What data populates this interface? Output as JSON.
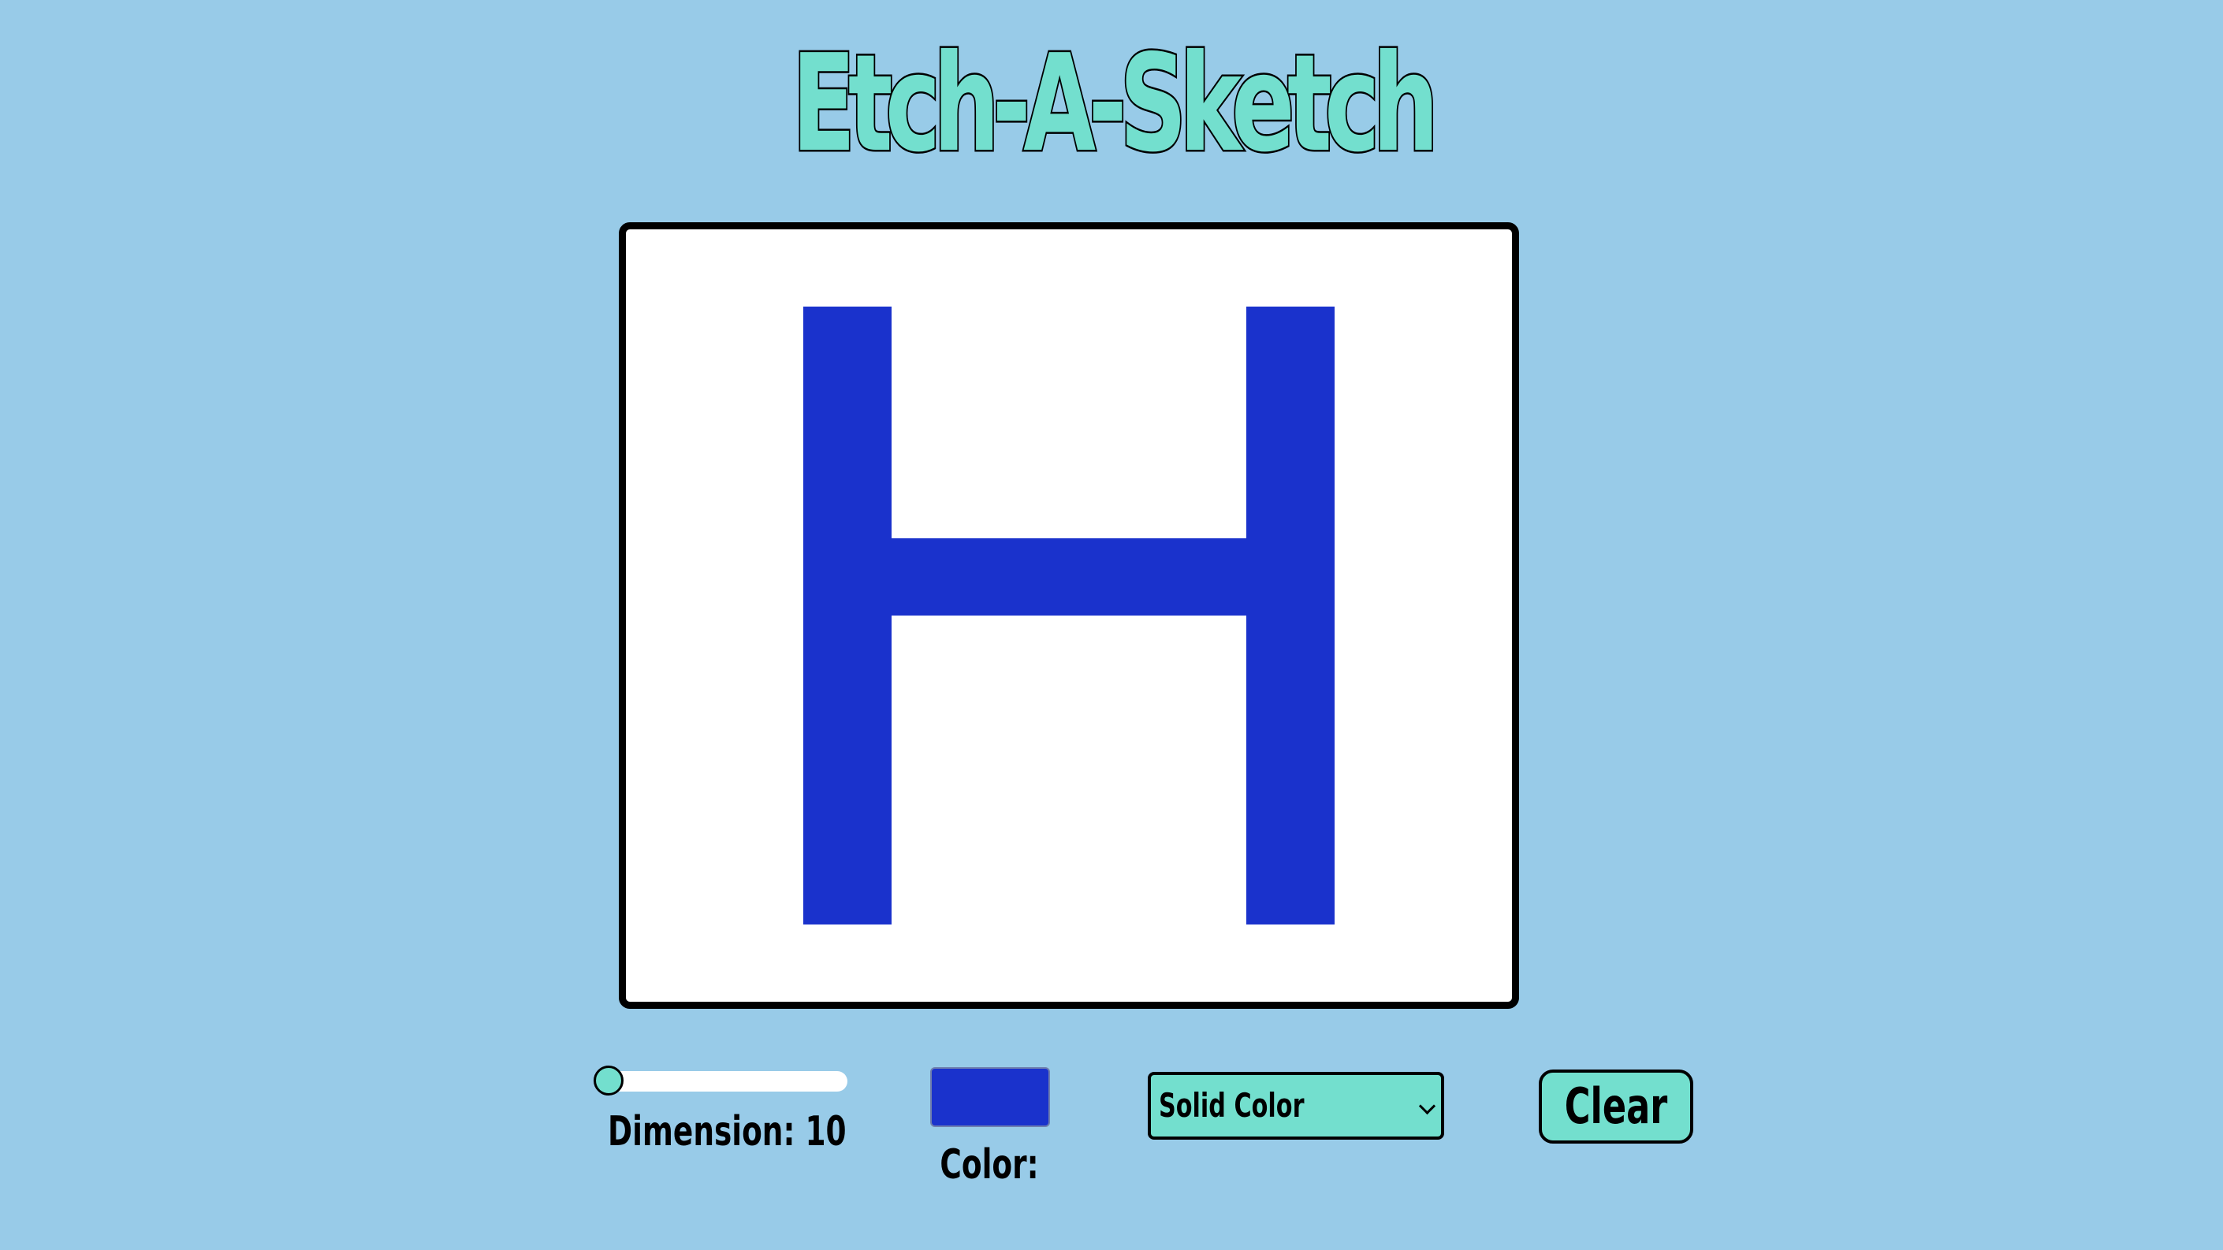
{
  "app": {
    "title": "Etch-A-Sketch"
  },
  "board": {
    "grid_size": 10,
    "background_color": "#ffffff",
    "paint_color": "#1a32cc",
    "filled_cells": [
      [
        1,
        2
      ],
      [
        1,
        7
      ],
      [
        2,
        2
      ],
      [
        2,
        7
      ],
      [
        3,
        2
      ],
      [
        3,
        7
      ],
      [
        4,
        2
      ],
      [
        4,
        3
      ],
      [
        4,
        4
      ],
      [
        4,
        5
      ],
      [
        4,
        6
      ],
      [
        4,
        7
      ],
      [
        5,
        2
      ],
      [
        5,
        7
      ],
      [
        6,
        2
      ],
      [
        6,
        7
      ],
      [
        7,
        2
      ],
      [
        7,
        7
      ],
      [
        8,
        2
      ],
      [
        8,
        7
      ]
    ]
  },
  "controls": {
    "dimension_label": "Dimension: 10",
    "dimension_value": 10,
    "color_label": "Color:",
    "color_value": "#1a32cc",
    "mode_select": {
      "selected": "Solid Color",
      "icon": "chevron-down-icon"
    },
    "clear_label": "Clear"
  },
  "colors": {
    "background": "#98cbe8",
    "accent": "#73dfce",
    "paint": "#1a32cc"
  }
}
